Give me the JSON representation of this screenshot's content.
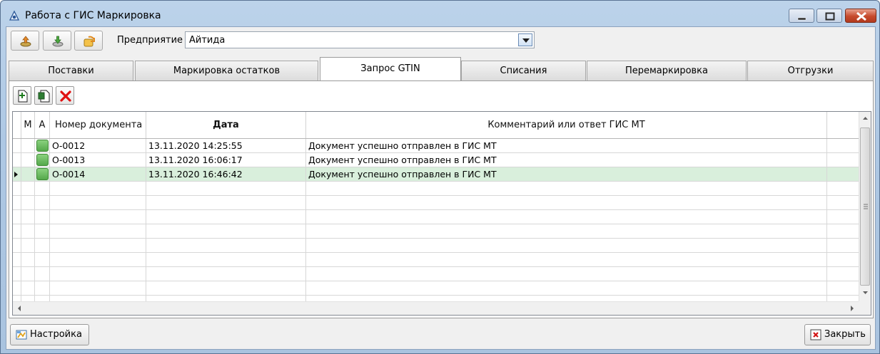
{
  "window": {
    "title": "Работа с ГИС Маркировка",
    "titlebar_color": "#bcd3ea",
    "close_color": "#c64a2c"
  },
  "toolbar": {
    "enterprise_label": "Предприятие",
    "enterprise_value": "Айтида"
  },
  "tabs": [
    {
      "label": "Поставки",
      "active": false
    },
    {
      "label": "Маркировка остатков",
      "active": false
    },
    {
      "label": "Запрос GTIN",
      "active": true
    },
    {
      "label": "Списания",
      "active": false
    },
    {
      "label": "Перемаркировка",
      "active": false
    },
    {
      "label": "Отгрузки",
      "active": false
    }
  ],
  "grid": {
    "columns": [
      "М",
      "А",
      "Номер документа",
      "Дата",
      "Комментарий или ответ ГИС МТ"
    ],
    "rows": [
      {
        "number": "О-0012",
        "date": "13.11.2020 14:25:55",
        "comment": "Документ успешно отправлен в ГИС МТ"
      },
      {
        "number": "О-0013",
        "date": "13.11.2020 16:06:17",
        "comment": "Документ успешно отправлен в ГИС МТ"
      },
      {
        "number": "О-0014",
        "date": "13.11.2020 16:46:42",
        "comment": "Документ успешно отправлен в ГИС МТ"
      }
    ],
    "selected_row_color": "#d9efdc",
    "status_color": "#6cbf62"
  },
  "footer": {
    "settings_label": "Настройка",
    "close_label": "Закрыть"
  }
}
